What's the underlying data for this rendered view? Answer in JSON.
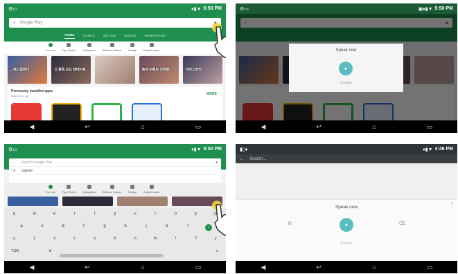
{
  "panel1": {
    "time": "5:50 PM",
    "search_placeholder": "Google Play",
    "tabs": [
      "HOME",
      "GAMES",
      "MOVIES",
      "BOOKS",
      "NEWSSTAND"
    ],
    "subnav": [
      "For You",
      "Top Charts",
      "Categories",
      "Editors' Choice",
      "Family",
      "Early Access"
    ],
    "banners": [
      "...에스킬위더",
      "신 중독 모드 캠테어로",
      "",
      "축제 이벤트 진행중!",
      "이버스틴터"
    ],
    "previous_title": "Previously installed apps",
    "previous_subtitle": "Give one a go",
    "more": "MORE"
  },
  "panel2": {
    "time": "5:50 PM",
    "speak_now": "Speak now",
    "google": "Google"
  },
  "panel3": {
    "time": "5:50 PM",
    "search_placeholder": "Search Google Play",
    "suggestion": "capture",
    "subnav": [
      "For You",
      "Top Charts",
      "Categories",
      "Editors' Choice",
      "Family",
      "Early Access"
    ],
    "row1": [
      "q",
      "w",
      "e",
      "r",
      "t",
      "y",
      "u",
      "i",
      "o",
      "p"
    ],
    "row2": [
      "a",
      "s",
      "d",
      "f",
      "g",
      "h",
      "j",
      "k",
      "l"
    ],
    "row3": [
      "z",
      "x",
      "c",
      "v",
      "b",
      "n",
      "m",
      "!",
      "?"
    ],
    "symbols": "?123"
  },
  "panel4": {
    "time": "4:46 PM",
    "search_placeholder": "Search...",
    "speak_now": "Speak now",
    "google": "Google"
  },
  "colors": {
    "play_green": "#1e8f4e",
    "mic_teal": "#5bbcc0",
    "tap_yellow": "#f2d33a"
  }
}
